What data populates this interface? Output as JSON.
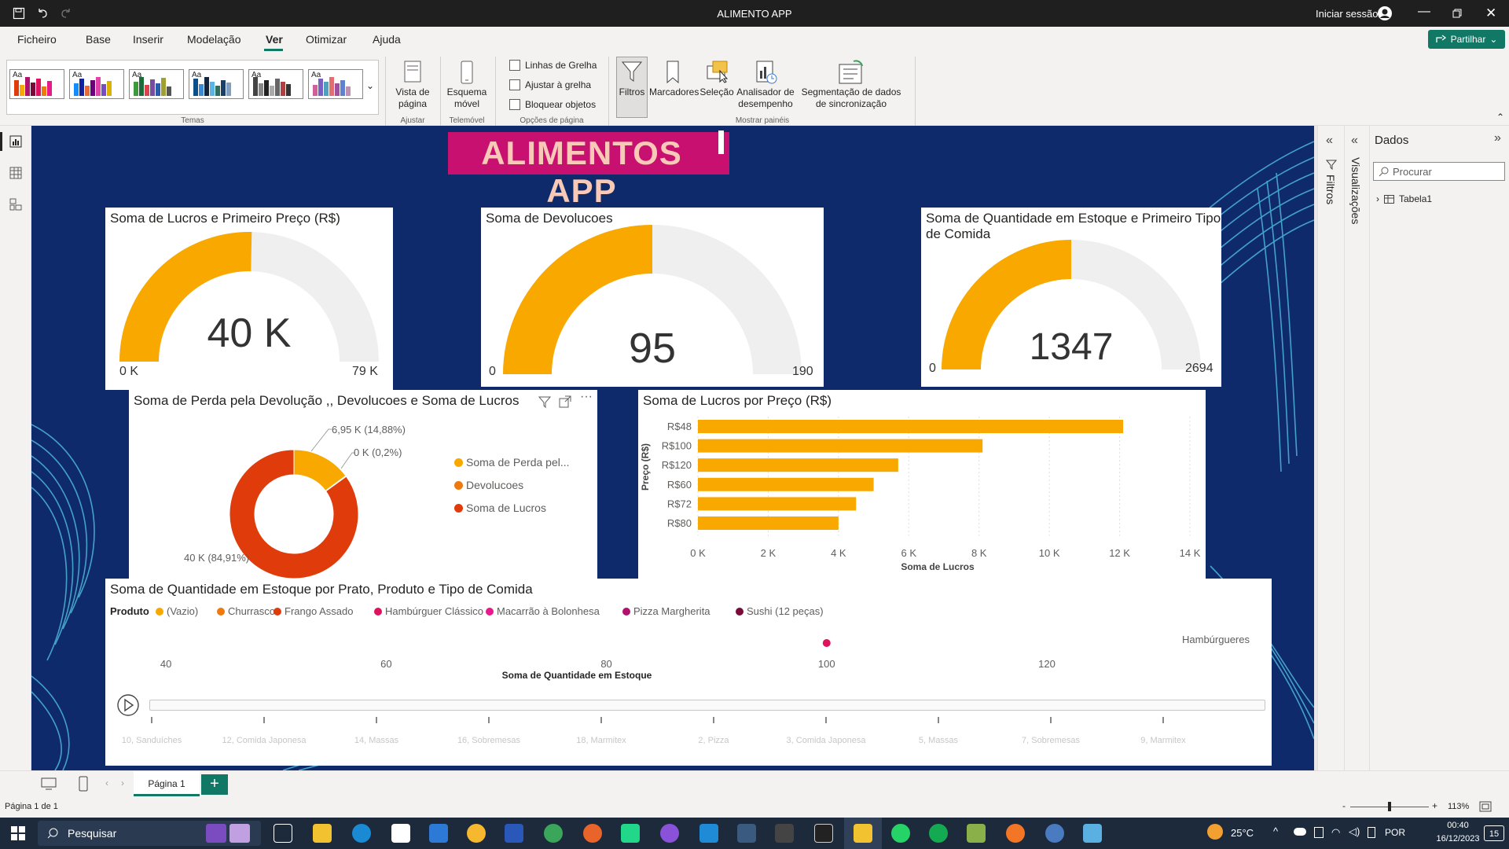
{
  "app": {
    "title": "ALIMENTO APP",
    "signin": "Iniciar sessão",
    "share": "Partilhar"
  },
  "menu": {
    "items": [
      "Ficheiro",
      "Base",
      "Inserir",
      "Modelação",
      "Ver",
      "Otimizar",
      "Ajuda"
    ],
    "active": "Ver"
  },
  "ribbon": {
    "themes_label": "Temas",
    "vista_label": "Vista de página",
    "ajustar_label": "Ajustar",
    "esquema_label": "Esquema móvel",
    "telemovel_label": "Telemóvel",
    "checkboxes": [
      "Linhas de Grelha",
      "Ajustar à grelha",
      "Bloquear objetos"
    ],
    "opcoes_label": "Opções de página",
    "panes": [
      "Filtros",
      "Marcadores",
      "Seleção",
      "Analisador de desempenho",
      "Segmentação de dados de sincronização"
    ],
    "mostrar_label": "Mostrar painéis",
    "theme_aa": "Aa"
  },
  "report": {
    "banner": "ALIMENTOS APP"
  },
  "gauges": [
    {
      "title": "Soma de Lucros e Primeiro Preço (R$)",
      "value_label": "40 K",
      "min_label": "0 K",
      "max_label": "79 K",
      "value": 40,
      "max": 79
    },
    {
      "title": "Soma de Devolucoes",
      "value_label": "95",
      "min_label": "0",
      "max_label": "190",
      "value": 95,
      "max": 190
    },
    {
      "title": "Soma de Quantidade em Estoque e Primeiro Tipo de Comida",
      "value_label": "1347",
      "min_label": "0",
      "max_label": "2694",
      "value": 1347,
      "max": 2694
    }
  ],
  "donut": {
    "title": "Soma de Perda pela Devolução ,, Devolucoes e Soma de Lucros",
    "labels": [
      "6,95 K (14,88%)",
      "0 K (0,2%)",
      "40 K (84,91%)"
    ],
    "legend": [
      "Soma de Perda pel...",
      "Devolucoes",
      "Soma de Lucros"
    ],
    "colors": [
      "#f9a800",
      "#ee7a0e",
      "#e03b0b"
    ]
  },
  "bar_chart": {
    "title": "Soma de Lucros por Preço (R$)",
    "xlabel": "Soma de Lucros",
    "ylabel": "Preço (R$)",
    "xticks": [
      "0 K",
      "2 K",
      "4 K",
      "6 K",
      "8 K",
      "10 K",
      "12 K",
      "14 K"
    ]
  },
  "scatter": {
    "title": "Soma de Quantidade em Estoque por Prato, Produto e Tipo de Comida",
    "legend_title": "Produto",
    "legend": [
      "(Vazio)",
      "Churrasco",
      "Frango Assado",
      "Hambúrguer Clássico",
      "Macarrão à Bolonhesa",
      "Pizza Margherita",
      "Sushi (12 peças)"
    ],
    "legend_colors": [
      "#f9a800",
      "#ee7a0e",
      "#e03b0b",
      "#e0115f",
      "#e8198b",
      "#b0106e",
      "#7a0a3a"
    ],
    "xticks": [
      "40",
      "60",
      "80",
      "100",
      "120"
    ],
    "xlabel": "Soma de Quantidade em Estoque",
    "point_label": "Hambúrgueres",
    "play_axis": [
      "10, Sanduíches",
      "12, Comida Japonesa",
      "14, Massas",
      "16, Sobremesas",
      "18, Marmitex",
      "2, Pizza",
      "3, Comida Japonesa",
      "5, Massas",
      "7, Sobremesas",
      "9, Marmitex"
    ]
  },
  "panes": {
    "filters": "Filtros",
    "visualizations": "Visualizações",
    "data_title": "Dados",
    "search_placeholder": "Procurar",
    "table": "Tabela1"
  },
  "pages": {
    "tab": "Página 1",
    "add": "+",
    "status": "Página 1 de 1",
    "zoom": "113%"
  },
  "taskbar": {
    "search": "Pesquisar",
    "weather": "25°C",
    "lang": "POR",
    "time": "00:40",
    "date": "16/12/2023",
    "notif": "15"
  },
  "chart_data": [
    {
      "type": "bar",
      "title": "Soma de Lucros por Preço (R$)",
      "categories": [
        "R$48",
        "R$100",
        "R$120",
        "R$60",
        "R$72",
        "R$80"
      ],
      "values": [
        12100,
        8100,
        5700,
        5000,
        4500,
        4000
      ],
      "xlabel": "Soma de Lucros",
      "ylabel": "Preço (R$)",
      "xlim": [
        0,
        14000
      ]
    },
    {
      "type": "pie",
      "title": "Soma de Perda pela Devolução ,, Devolucoes e Soma de Lucros",
      "categories": [
        "Soma de Perda pela Devolução",
        "Devolucoes",
        "Soma de Lucros"
      ],
      "values": [
        14.88,
        0.2,
        84.91
      ]
    },
    {
      "type": "scatter",
      "title": "Soma de Quantidade em Estoque por Prato, Produto e Tipo de Comida",
      "xlabel": "Soma de Quantidade em Estoque",
      "xlim": [
        30,
        120
      ],
      "points": [
        {
          "x": 100,
          "label": "Hambúrgueres"
        }
      ]
    }
  ]
}
